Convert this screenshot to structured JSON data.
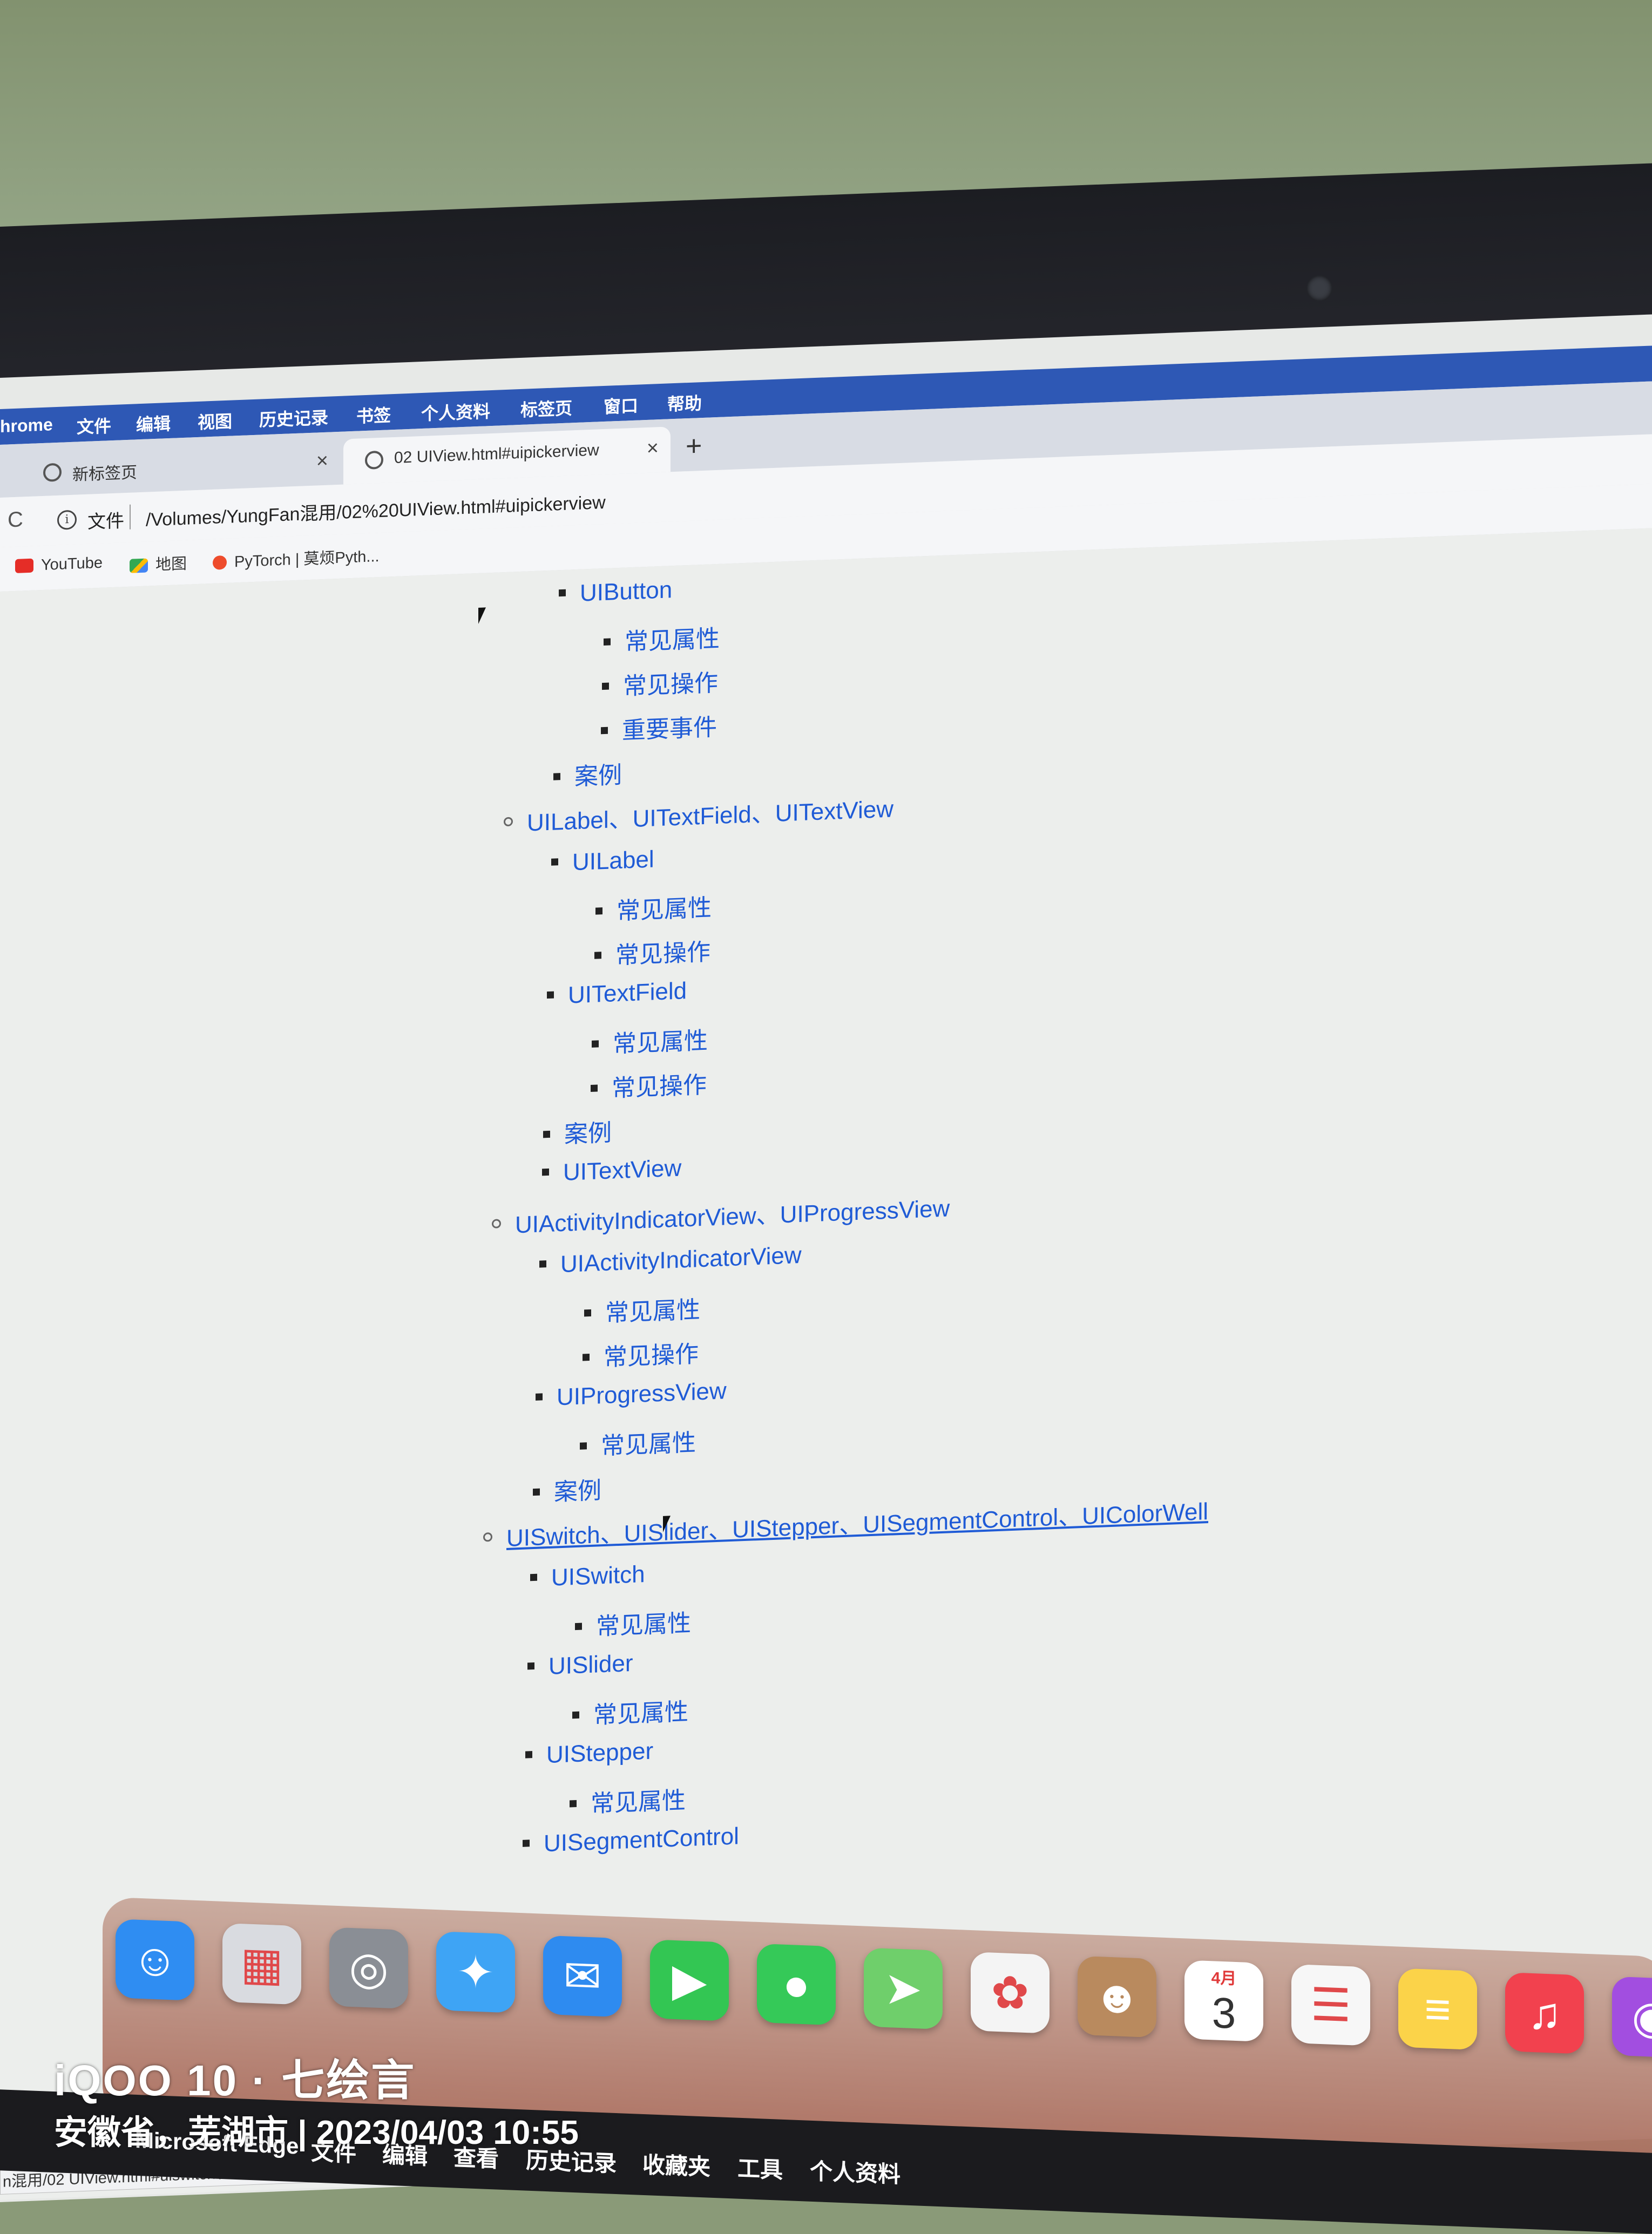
{
  "menubar": {
    "items": [
      "hrome",
      "文件",
      "编辑",
      "视图",
      "历史记录",
      "书签",
      "个人资料",
      "标签页",
      "窗口",
      "帮助"
    ]
  },
  "tabs": [
    {
      "label": "新标签页",
      "close": "×",
      "icon": "chrome-icon"
    },
    {
      "label": "02 UIView.html#uipickerview",
      "close": "×",
      "icon": "globe-icon"
    }
  ],
  "toolbar": {
    "new_tab": "+",
    "reload": "C",
    "info": "i",
    "file_label": "文件",
    "url": "/Volumes/YungFan混用/02%20UIView.html#uipickerview"
  },
  "bookmarks": [
    "YouTube",
    "地图",
    "PyTorch | 莫烦Pyth..."
  ],
  "outline": [
    {
      "text": "UIButton",
      "level": 2
    },
    {
      "text": "常见属性",
      "level": 3
    },
    {
      "text": "常见操作",
      "level": 3
    },
    {
      "text": "重要事件",
      "level": 3
    },
    {
      "text": "案例",
      "level": 2
    },
    {
      "text": "UILabel、UITextField、UITextView",
      "level": 1
    },
    {
      "text": "UILabel",
      "level": 2
    },
    {
      "text": "常见属性",
      "level": 3
    },
    {
      "text": "常见操作",
      "level": 3
    },
    {
      "text": "UITextField",
      "level": 2
    },
    {
      "text": "常见属性",
      "level": 3
    },
    {
      "text": "常见操作",
      "level": 3
    },
    {
      "text": "案例",
      "level": 2
    },
    {
      "text": "UITextView",
      "level": 2
    },
    {
      "text": "UIActivityIndicatorView、UIProgressView",
      "level": 1
    },
    {
      "text": "UIActivityIndicatorView",
      "level": 2
    },
    {
      "text": "常见属性",
      "level": 3
    },
    {
      "text": "常见操作",
      "level": 3
    },
    {
      "text": "UIProgressView",
      "level": 2
    },
    {
      "text": "常见属性",
      "level": 3
    },
    {
      "text": "案例",
      "level": 2
    },
    {
      "text": "UISwitch、UISlider、UIStepper、UISegmentControl、UIColorWell",
      "level": 1,
      "hover": true
    },
    {
      "text": "UISwitch",
      "level": 2
    },
    {
      "text": "常见属性",
      "level": 3
    },
    {
      "text": "UISlider",
      "level": 2
    },
    {
      "text": "常见属性",
      "level": 3
    },
    {
      "text": "UIStepper",
      "level": 2
    },
    {
      "text": "常见属性",
      "level": 3
    },
    {
      "text": "UISegmentControl",
      "level": 2
    }
  ],
  "status_bar": "n混用/02 UIView.html#uiswitch、uislider、uistepper、uisegmentcontrol、uicolorwell",
  "dock": [
    {
      "name": "finder-icon",
      "color": "#2f8df2"
    },
    {
      "name": "launchpad-icon",
      "color": "#d9dbe0"
    },
    {
      "name": "screenshot-icon",
      "color": "#8a8e95"
    },
    {
      "name": "safari-icon",
      "color": "#3ea4f5"
    },
    {
      "name": "mail-icon",
      "color": "#2e8bf0"
    },
    {
      "name": "facetime-icon",
      "color": "#33c653"
    },
    {
      "name": "messages-icon",
      "color": "#35c958"
    },
    {
      "name": "maps-icon",
      "color": "#6fcf6b"
    },
    {
      "name": "photos-icon",
      "color": "#f4f4f4"
    },
    {
      "name": "contacts-icon",
      "color": "#b98a5e"
    },
    {
      "name": "calendar-icon",
      "color": "#ffffff",
      "month": "4月",
      "day": "3"
    },
    {
      "name": "reminders-icon",
      "color": "#f7f7f7"
    },
    {
      "name": "notes-icon",
      "color": "#fbd349"
    },
    {
      "name": "music-icon",
      "color": "#f2414e"
    },
    {
      "name": "podcasts-icon",
      "color": "#a24ee0"
    }
  ],
  "mac_menubar": [
    "Microsoft Edge",
    "文件",
    "编辑",
    "查看",
    "历史记录",
    "收藏夹",
    "工具",
    "个人资料"
  ],
  "watermark": {
    "line1": "iQOO 10 · 七绘言",
    "line2": "安徽省，芜湖市 | 2023/04/03 10:55"
  }
}
